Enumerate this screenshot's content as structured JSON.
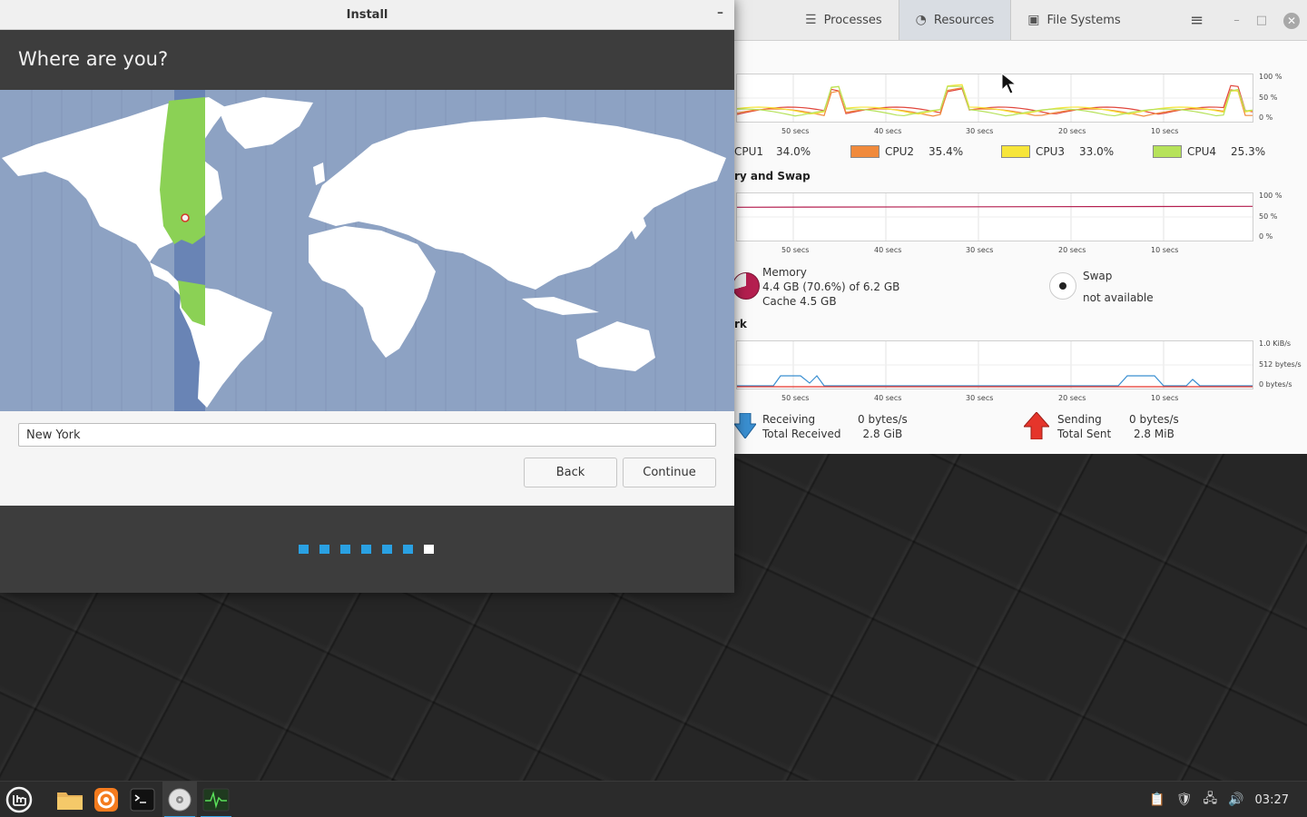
{
  "install": {
    "title": "Install",
    "minimize": "–",
    "heading": "Where are you?",
    "city_value": "New York",
    "back_label": "Back",
    "continue_label": "Continue",
    "progress": {
      "total_steps": 7,
      "current_step": 7
    }
  },
  "sysmon": {
    "tabs": [
      {
        "label": "Processes",
        "icon": "list-icon"
      },
      {
        "label": "Resources",
        "icon": "gauge-icon"
      },
      {
        "label": "File Systems",
        "icon": "disk-icon"
      }
    ],
    "active_tab": "Resources",
    "cpu": {
      "y_labels": [
        "100 %",
        "50 %",
        "0 %"
      ],
      "time_labels": [
        "50 secs",
        "40 secs",
        "30 secs",
        "20 secs",
        "10 secs"
      ],
      "legend": [
        {
          "name": "CPU1",
          "value": "34.0%",
          "color": "#e0463c"
        },
        {
          "name": "CPU2",
          "value": "35.4%",
          "color": "#f08a3c"
        },
        {
          "name": "CPU3",
          "value": "33.0%",
          "color": "#f7e53a"
        },
        {
          "name": "CPU4",
          "value": "25.3%",
          "color": "#b6e25a"
        }
      ]
    },
    "memory": {
      "section_title": "ry and Swap",
      "y_labels": [
        "100 %",
        "50 %",
        "0 %"
      ],
      "time_labels": [
        "50 secs",
        "40 secs",
        "30 secs",
        "20 secs",
        "10 secs"
      ],
      "mem_label": "Memory",
      "mem_value": "4.4 GB (70.6%) of 6.2 GB",
      "mem_cache": "Cache 4.5 GB",
      "mem_percent": 70.6,
      "swap_label": "Swap",
      "swap_value": "not available"
    },
    "network": {
      "section_title": "rk",
      "y_labels": [
        "1.0 KiB/s",
        "512 bytes/s",
        "0 bytes/s"
      ],
      "time_labels": [
        "50 secs",
        "40 secs",
        "30 secs",
        "20 secs",
        "10 secs"
      ],
      "recv_label": "Receiving",
      "recv_total_label": "Total Received",
      "recv_rate": "0 bytes/s",
      "recv_total": "2.8 GiB",
      "send_label": "Sending",
      "send_total_label": "Total Sent",
      "send_rate": "0 bytes/s",
      "send_total": "2.8 MiB"
    }
  },
  "taskbar": {
    "clock": "03:27"
  },
  "colors": {
    "accent": "#2aa1e3",
    "map_ocean": "#8da2c3",
    "timezone_highlight": "#8bd155",
    "memory_pie": "#b41e4f"
  }
}
